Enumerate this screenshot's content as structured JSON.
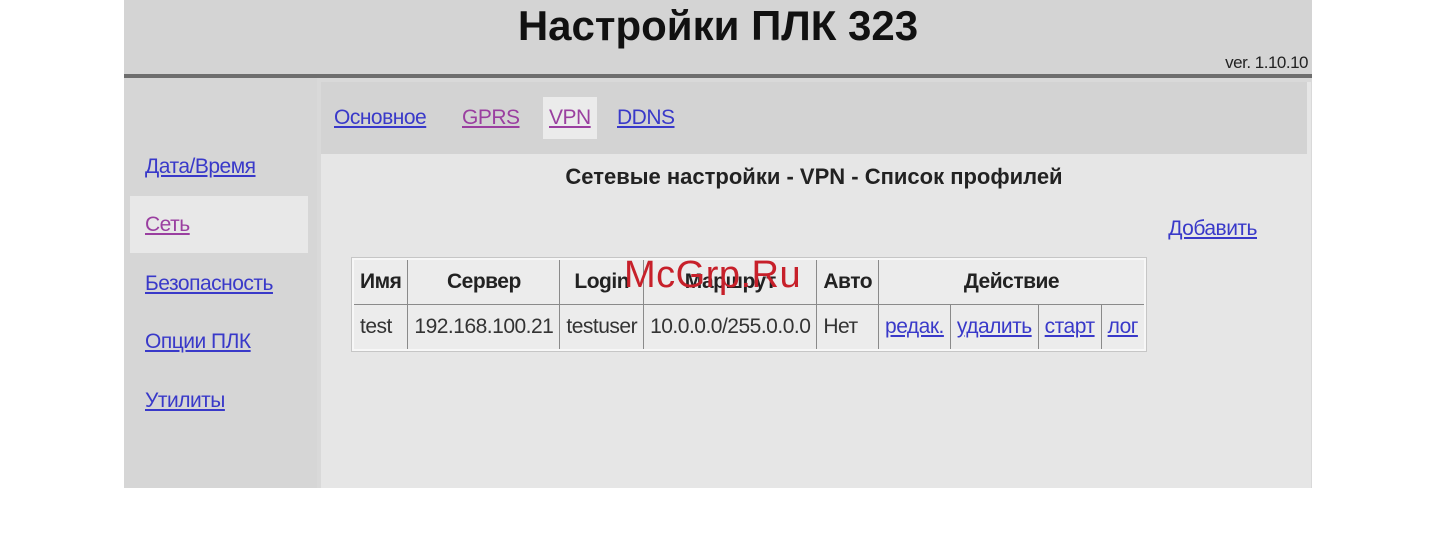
{
  "header": {
    "title": "Настройки ПЛК 323",
    "version": "ver. 1.10.10"
  },
  "sidebar": {
    "items": [
      {
        "label": "Дата/Время"
      },
      {
        "label": "Сеть",
        "active": true
      },
      {
        "label": "Безопасность"
      },
      {
        "label": "Опции ПЛК"
      },
      {
        "label": "Утилиты"
      }
    ]
  },
  "tabs": [
    {
      "label": "Основное",
      "color": "#3939c9"
    },
    {
      "label": "GPRS",
      "color": "#9a3fa0"
    },
    {
      "label": "VPN",
      "color": "#9a3fa0",
      "active": true
    },
    {
      "label": "DDNS",
      "color": "#3939c9"
    }
  ],
  "main": {
    "section_title": "Сетевые настройки - VPN - Список профилей",
    "add_label": "Добавить"
  },
  "table": {
    "headers": {
      "name": "Имя",
      "server": "Сервер",
      "login": "Login",
      "route": "Маршрут",
      "auto": "Авто",
      "action": "Действие"
    },
    "rows": [
      {
        "name": "test",
        "server": "192.168.100.21",
        "login": "testuser",
        "route": "10.0.0.0/255.0.0.0",
        "auto": "Нет",
        "actions": {
          "edit": "редак.",
          "delete": "удалить",
          "start": "старт",
          "log": "лог"
        }
      }
    ]
  },
  "watermark": "McGrp.Ru",
  "colors": {
    "link": "#3939c9",
    "visited_link": "#9a3fa0",
    "watermark": "#c7202a"
  }
}
